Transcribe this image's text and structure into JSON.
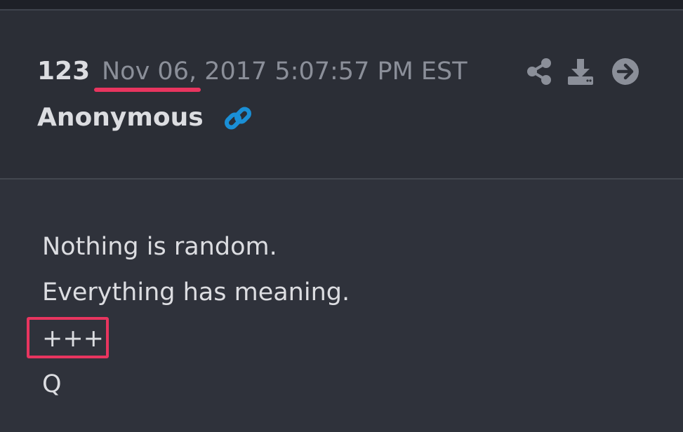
{
  "post": {
    "number": "123",
    "date": "Nov 06, 2017 5:07:57 PM EST",
    "author": "Anonymous",
    "lines": [
      "Nothing is random.",
      "Everything has meaning.",
      "+++",
      "Q"
    ]
  },
  "icons": {
    "share": "share-icon",
    "download": "download-icon",
    "forward": "arrow-right-circle-icon",
    "link": "link-icon"
  },
  "colors": {
    "background": "#2f323b",
    "header_background": "#2b2e36",
    "text": "#dcdde1",
    "muted_text": "#8b8f99",
    "icon": "#8b8f99",
    "link_icon": "#1a8fd6",
    "annotation": "#e8355f"
  }
}
